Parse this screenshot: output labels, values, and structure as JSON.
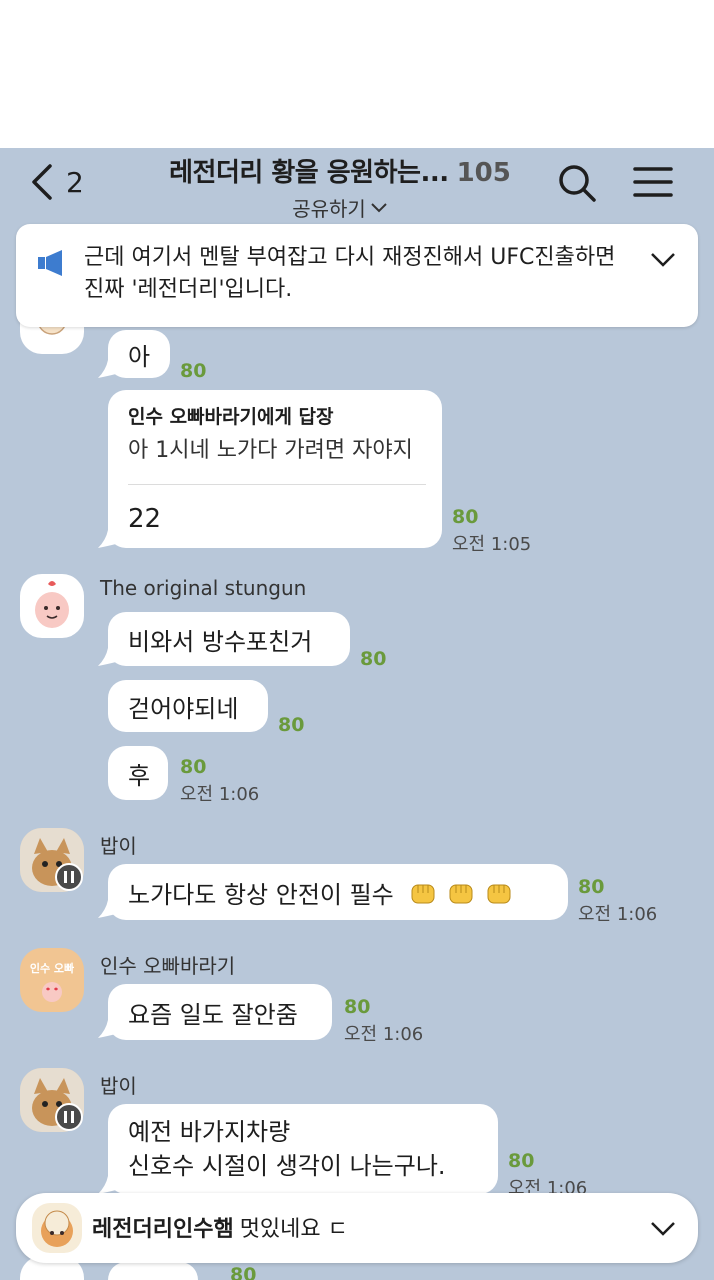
{
  "header": {
    "back_count": "2",
    "title": "레전더리 황을 응원하는...",
    "member_count": "105",
    "share_label": "공유하기"
  },
  "notice": {
    "text": "근데 여기서 멘탈 부여잡고 다시 재정진해서 UFC진출하면 진짜 '레전더리'입니다."
  },
  "messages": {
    "m1": {
      "text": "아",
      "unread": "80"
    },
    "reply": {
      "reply_to": "인수 오빠바라기에게 답장",
      "quote": "아 1시네 노가다 가려면 자야지",
      "text": "22",
      "unread": "80",
      "time": "오전 1:05"
    },
    "group2": {
      "sender": "The original stungun",
      "m1": {
        "text": "비와서 방수포친거",
        "unread": "80"
      },
      "m2": {
        "text": "걷어야되네",
        "unread": "80"
      },
      "m3": {
        "text": "후",
        "unread": "80",
        "time": "오전 1:06"
      }
    },
    "group3": {
      "sender": "밥이",
      "m1": {
        "text": "노가다도 항상 안전이 필수",
        "unread": "80",
        "time": "오전 1:06"
      }
    },
    "group4": {
      "sender": "인수 오빠바라기",
      "avatar_label": "인수 오빠",
      "m1": {
        "text": "요즘 일도 잘안줌",
        "unread": "80",
        "time": "오전 1:06"
      }
    },
    "group5": {
      "sender": "밥이",
      "m1": {
        "line1": "예전 바가지차량",
        "line2": "신호수 시절이 생각이 나는구나.",
        "unread": "80",
        "time": "오전 1:06"
      }
    },
    "partial_unread": "80"
  },
  "bottom_bar": {
    "name": "레전더리인수햄",
    "text": "멋있네요 ㄷ"
  },
  "colors": {
    "chat_background": "#b8c7d9",
    "unread": "#6a9a3c",
    "notice_icon": "#3d7ccf"
  }
}
